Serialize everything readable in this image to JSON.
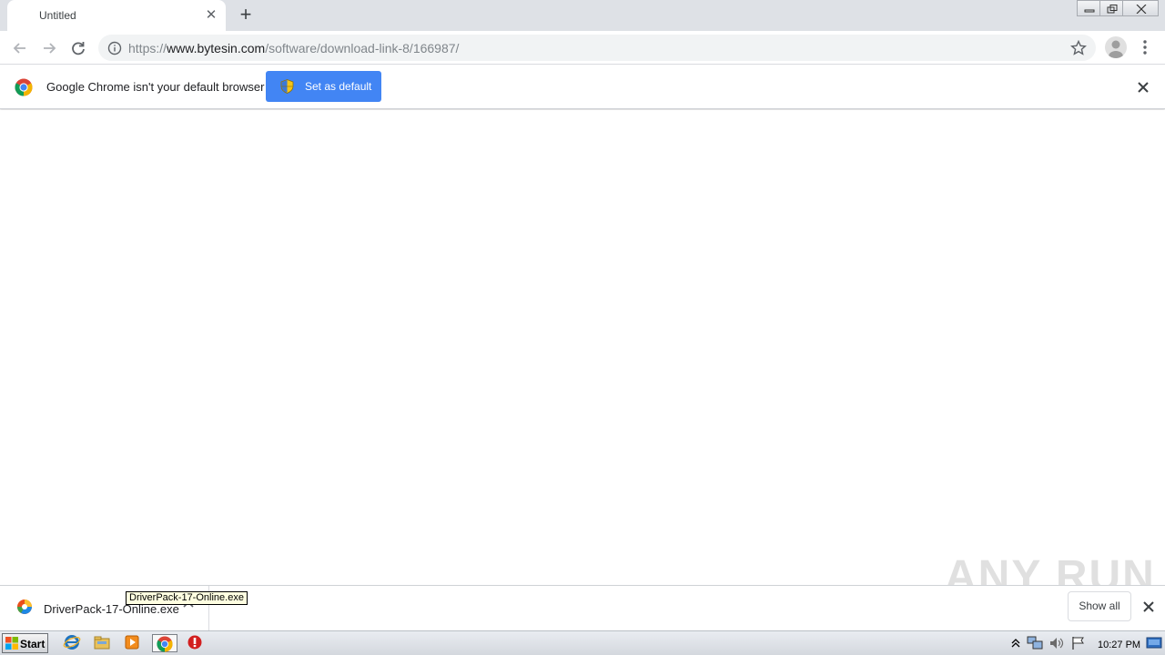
{
  "tab": {
    "title": "Untitled"
  },
  "address_bar": {
    "scheme": "https://",
    "host": "www.bytesin.com",
    "path": "/software/download-link-8/166987/"
  },
  "infobar": {
    "message": "Google Chrome isn't your default browser",
    "button_label": "Set as default"
  },
  "download_shelf": {
    "file_name": "DriverPack-17-Online.exe",
    "tooltip": "DriverPack-17-Online.exe",
    "show_all_label": "Show all"
  },
  "watermark": {
    "text": "ANY RUN"
  },
  "taskbar": {
    "start_label": "Start",
    "clock": "10:27 PM"
  },
  "colors": {
    "accent_blue": "#4285f4",
    "tab_strip": "#dee1e6",
    "omnibox": "#f1f3f4"
  }
}
